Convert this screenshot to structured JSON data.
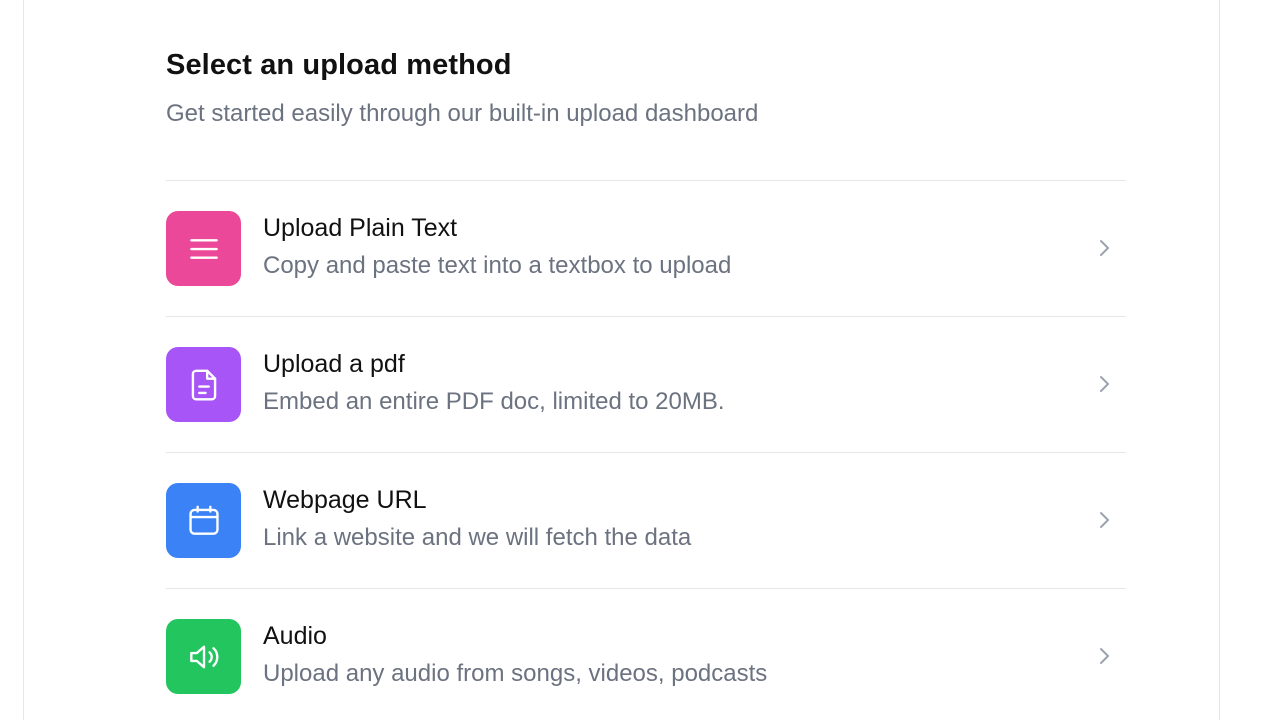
{
  "header": {
    "title": "Select an upload method",
    "subtitle": "Get started easily through our built-in upload dashboard"
  },
  "methods": [
    {
      "title": "Upload Plain Text",
      "description": "Copy and paste text into a textbox to upload",
      "icon": "menu-lines-icon",
      "color": "#ec4899"
    },
    {
      "title": "Upload a pdf",
      "description": "Embed an entire PDF doc, limited to 20MB.",
      "icon": "document-icon",
      "color": "#a855f7"
    },
    {
      "title": "Webpage URL",
      "description": "Link a website and we will fetch the data",
      "icon": "calendar-icon",
      "color": "#3b82f6"
    },
    {
      "title": "Audio",
      "description": "Upload any audio from songs, videos, podcasts",
      "icon": "speaker-icon",
      "color": "#22c55e"
    }
  ]
}
